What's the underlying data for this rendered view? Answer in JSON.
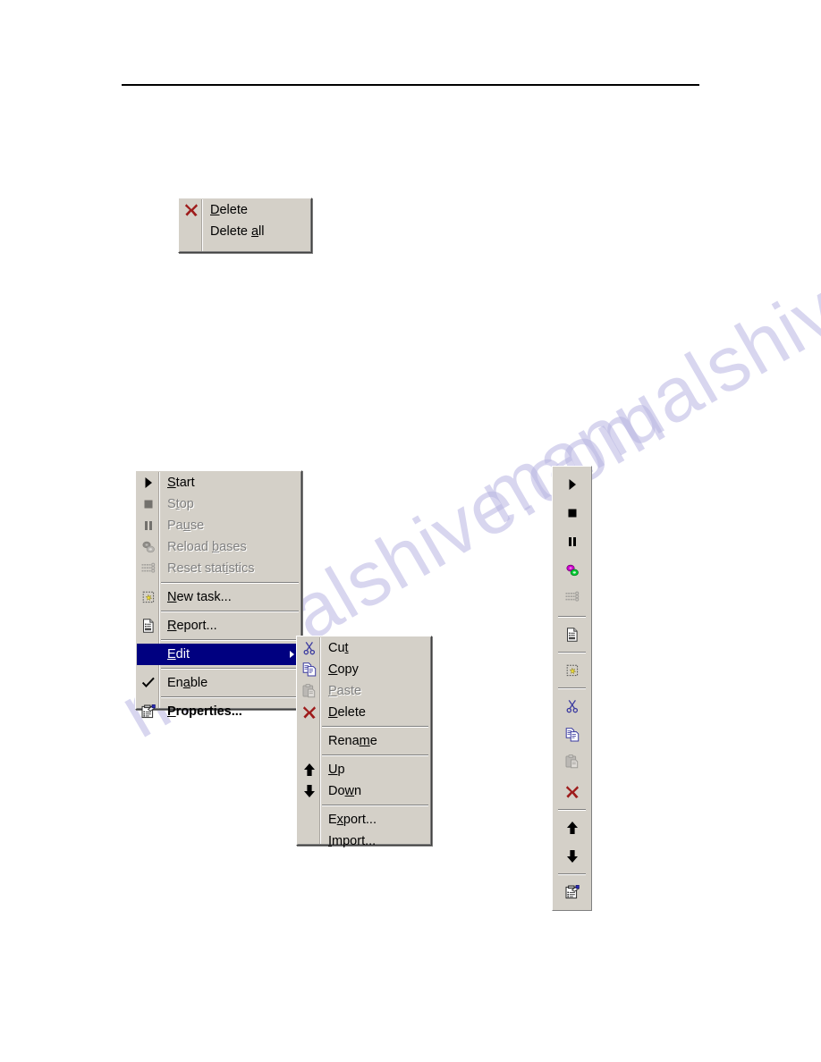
{
  "page": {
    "rule": "horizontal-rule",
    "watermark_text": "manualshive.com"
  },
  "delete_menu": {
    "name": "delete-context-menu",
    "items": [
      {
        "id": "delete",
        "label": "Delete",
        "mnemonic": "D",
        "icon": "delete-x-icon",
        "enabled": true,
        "bold": false
      },
      {
        "id": "delete_all",
        "label": "Delete all",
        "mnemonic": "a",
        "icon": "none",
        "enabled": true,
        "bold": false
      }
    ]
  },
  "main_menu": {
    "name": "task-context-menu",
    "items": [
      {
        "id": "start",
        "label": "Start",
        "mnemonic": "S",
        "icon": "play-icon",
        "enabled": true,
        "bold": false,
        "selected": false,
        "submenu": false,
        "checked": false
      },
      {
        "id": "stop",
        "label": "Stop",
        "mnemonic": "t",
        "icon": "stop-icon",
        "enabled": false,
        "bold": false,
        "selected": false,
        "submenu": false,
        "checked": false
      },
      {
        "id": "pause",
        "label": "Pause",
        "mnemonic": "u",
        "icon": "pause-icon",
        "enabled": false,
        "bold": false,
        "selected": false,
        "submenu": false,
        "checked": false
      },
      {
        "id": "reload",
        "label": "Reload bases",
        "mnemonic": "b",
        "icon": "reload-bases-icon",
        "enabled": false,
        "bold": false,
        "selected": false,
        "submenu": false,
        "checked": false
      },
      {
        "id": "reset_stats",
        "label": "Reset statistics",
        "mnemonic": "i",
        "icon": "reset-stats-icon",
        "enabled": false,
        "bold": false,
        "selected": false,
        "submenu": false,
        "checked": false
      },
      {
        "id": "sep1",
        "label": "",
        "mnemonic": "",
        "icon": "separator",
        "enabled": true,
        "bold": false,
        "selected": false,
        "submenu": false,
        "checked": false
      },
      {
        "id": "new_task",
        "label": "New task...",
        "mnemonic": "N",
        "icon": "new-task-icon",
        "enabled": true,
        "bold": false,
        "selected": false,
        "submenu": false,
        "checked": false
      },
      {
        "id": "sep2",
        "label": "",
        "mnemonic": "",
        "icon": "separator",
        "enabled": true,
        "bold": false,
        "selected": false,
        "submenu": false,
        "checked": false
      },
      {
        "id": "report",
        "label": "Report...",
        "mnemonic": "R",
        "icon": "report-icon",
        "enabled": true,
        "bold": false,
        "selected": false,
        "submenu": false,
        "checked": false
      },
      {
        "id": "sep3",
        "label": "",
        "mnemonic": "",
        "icon": "separator",
        "enabled": true,
        "bold": false,
        "selected": false,
        "submenu": false,
        "checked": false
      },
      {
        "id": "edit",
        "label": "Edit",
        "mnemonic": "E",
        "icon": "none",
        "enabled": true,
        "bold": false,
        "selected": true,
        "submenu": true,
        "checked": false
      },
      {
        "id": "sep4",
        "label": "",
        "mnemonic": "",
        "icon": "separator",
        "enabled": true,
        "bold": false,
        "selected": false,
        "submenu": false,
        "checked": false
      },
      {
        "id": "enable",
        "label": "Enable",
        "mnemonic": "a",
        "icon": "checkmark-icon",
        "enabled": true,
        "bold": false,
        "selected": false,
        "submenu": false,
        "checked": true
      },
      {
        "id": "sep5",
        "label": "",
        "mnemonic": "",
        "icon": "separator",
        "enabled": true,
        "bold": false,
        "selected": false,
        "submenu": false,
        "checked": false
      },
      {
        "id": "properties",
        "label": "Properties...",
        "mnemonic": "P",
        "icon": "properties-icon",
        "enabled": true,
        "bold": true,
        "selected": false,
        "submenu": false,
        "checked": false
      }
    ]
  },
  "edit_submenu": {
    "name": "edit-submenu",
    "items": [
      {
        "id": "cut",
        "label": "Cut",
        "mnemonic": "t",
        "icon": "cut-icon",
        "enabled": true
      },
      {
        "id": "copy",
        "label": "Copy",
        "mnemonic": "C",
        "icon": "copy-icon",
        "enabled": true
      },
      {
        "id": "paste",
        "label": "Paste",
        "mnemonic": "P",
        "icon": "paste-icon",
        "enabled": false
      },
      {
        "id": "delete",
        "label": "Delete",
        "mnemonic": "D",
        "icon": "delete-x-icon",
        "enabled": true
      },
      {
        "id": "sep1",
        "label": "",
        "mnemonic": "",
        "icon": "separator",
        "enabled": true
      },
      {
        "id": "rename",
        "label": "Rename",
        "mnemonic": "m",
        "icon": "none",
        "enabled": true
      },
      {
        "id": "sep2",
        "label": "",
        "mnemonic": "",
        "icon": "separator",
        "enabled": true
      },
      {
        "id": "up",
        "label": "Up",
        "mnemonic": "U",
        "icon": "arrow-up-icon",
        "enabled": true
      },
      {
        "id": "down",
        "label": "Down",
        "mnemonic": "w",
        "icon": "arrow-down-icon",
        "enabled": true
      },
      {
        "id": "sep3",
        "label": "",
        "mnemonic": "",
        "icon": "separator",
        "enabled": true
      },
      {
        "id": "export",
        "label": "Export...",
        "mnemonic": "x",
        "icon": "none",
        "enabled": true
      },
      {
        "id": "import",
        "label": "Import...",
        "mnemonic": "I",
        "icon": "none",
        "enabled": true
      }
    ]
  },
  "toolbar": {
    "name": "vertical-toolbar",
    "orientation": "vertical",
    "buttons": [
      {
        "id": "start",
        "icon": "play-icon",
        "tooltip": "Start",
        "enabled": true
      },
      {
        "id": "stop",
        "icon": "stop-icon",
        "tooltip": "Stop",
        "enabled": true
      },
      {
        "id": "pause",
        "icon": "pause-icon",
        "tooltip": "Pause",
        "enabled": true
      },
      {
        "id": "reload",
        "icon": "reload-bases-icon",
        "tooltip": "Reload bases",
        "enabled": true
      },
      {
        "id": "reset_stats",
        "icon": "reset-stats-icon",
        "tooltip": "Reset statistics",
        "enabled": false
      },
      {
        "id": "sep1",
        "icon": "separator",
        "tooltip": "",
        "enabled": true
      },
      {
        "id": "report",
        "icon": "report-icon",
        "tooltip": "Report",
        "enabled": true
      },
      {
        "id": "sep2",
        "icon": "separator",
        "tooltip": "",
        "enabled": true
      },
      {
        "id": "new_task",
        "icon": "new-task-icon",
        "tooltip": "New task",
        "enabled": true
      },
      {
        "id": "sep3",
        "icon": "separator",
        "tooltip": "",
        "enabled": true
      },
      {
        "id": "cut",
        "icon": "cut-icon",
        "tooltip": "Cut",
        "enabled": true
      },
      {
        "id": "copy",
        "icon": "copy-icon",
        "tooltip": "Copy",
        "enabled": true
      },
      {
        "id": "paste",
        "icon": "paste-icon",
        "tooltip": "Paste",
        "enabled": false
      },
      {
        "id": "delete",
        "icon": "delete-x-icon",
        "tooltip": "Delete",
        "enabled": true
      },
      {
        "id": "sep4",
        "icon": "separator",
        "tooltip": "",
        "enabled": true
      },
      {
        "id": "up",
        "icon": "arrow-up-icon",
        "tooltip": "Up",
        "enabled": true
      },
      {
        "id": "down",
        "icon": "arrow-down-icon",
        "tooltip": "Down",
        "enabled": true
      },
      {
        "id": "sep5",
        "icon": "separator",
        "tooltip": "",
        "enabled": true
      },
      {
        "id": "properties",
        "icon": "properties-icon",
        "tooltip": "Properties",
        "enabled": true
      }
    ]
  },
  "colors": {
    "menu_face": "#d4d0c8",
    "highlight": "#000080",
    "highlight_text": "#ffffff",
    "disabled_text": "#808080",
    "delete_x": "#9e1b1b",
    "reload_magenta": "#cc00cc",
    "reload_green": "#00cc33",
    "cut_blue": "#3a3aa0"
  }
}
